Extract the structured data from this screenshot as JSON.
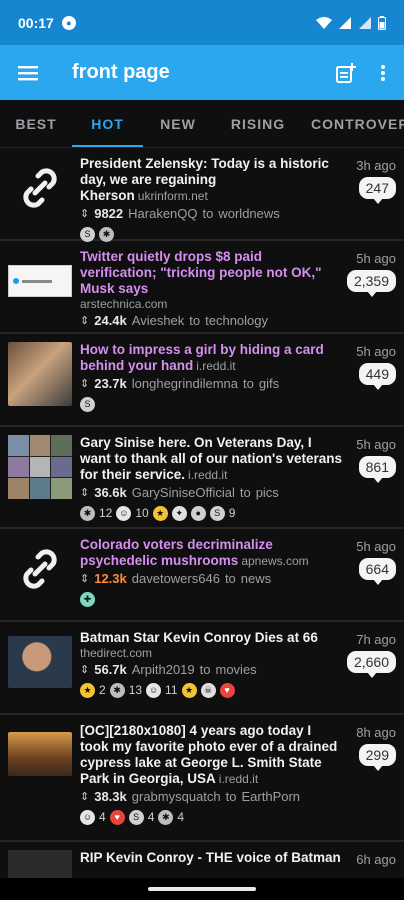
{
  "status": {
    "time": "00:17"
  },
  "app": {
    "title": "front page"
  },
  "tabs": [
    "BEST",
    "HOT",
    "NEW",
    "RISING",
    "CONTROVERSIAL"
  ],
  "posts": [
    {
      "title": "President Zelensky: Today is a historic day, we are regaining Kherson",
      "domain": "ukrinform.net",
      "score": "9822",
      "author": "HarakenQQ",
      "sub": "worldnews",
      "time": "3h ago",
      "comments": "247",
      "awards": []
    },
    {
      "title": "Twitter quietly drops $8 paid verification; \"tricking people not OK,\" Musk says",
      "domain": "arstechnica.com",
      "score": "24.4k",
      "author": "Avieshek",
      "sub": "technology",
      "time": "5h ago",
      "comments": "2,359",
      "awards": []
    },
    {
      "title": "How to impress a girl by hiding a card behind your hand",
      "domain": "i.redd.it",
      "score": "23.7k",
      "author": "longhegrindilemna",
      "sub": "gifs",
      "time": "5h ago",
      "comments": "449",
      "awards": []
    },
    {
      "title": "Gary Sinise here. On Veterans Day, I want to thank all of our nation's veterans for their service.",
      "domain": "i.redd.it",
      "score": "36.6k",
      "author": "GarySiniseOfficial",
      "sub": "pics",
      "time": "5h ago",
      "comments": "861",
      "awards": [
        "12",
        "10",
        "9"
      ]
    },
    {
      "title": "Colorado voters decriminalize psychedelic mushrooms",
      "domain": "apnews.com",
      "score": "12.3k",
      "author": "davetowers646",
      "sub": "news",
      "time": "5h ago",
      "comments": "664",
      "awards": []
    },
    {
      "title": "Batman Star Kevin Conroy Dies at 66",
      "domain": "thedirect.com",
      "score": "56.7k",
      "author": "Arpith2019",
      "sub": "movies",
      "time": "7h ago",
      "comments": "2,660",
      "awards": [
        "2",
        "13",
        "11"
      ]
    },
    {
      "title": "[OC][2180x1080] 4 years ago today I took my favorite photo ever of a drained cypress lake at George L. Smith State Park in Georgia, USA",
      "domain": "i.redd.it",
      "score": "38.3k",
      "author": "grabmysquatch",
      "sub": "EarthPorn",
      "time": "8h ago",
      "comments": "299",
      "awards": [
        "4",
        "4",
        "4"
      ]
    },
    {
      "title": "RIP Kevin Conroy - THE voice of Batman",
      "domain": "",
      "score": "",
      "author": "",
      "sub": "",
      "time": "6h ago",
      "comments": "",
      "awards": []
    }
  ],
  "connector": "to",
  "colors": {
    "accent": "#2aa7ee",
    "visited": "#d58ff0",
    "hot_score": "#ff8a3d"
  },
  "icons": [
    "menu-icon",
    "new-post-icon",
    "more-vert-icon",
    "link-icon",
    "updown-vote-icon"
  ]
}
